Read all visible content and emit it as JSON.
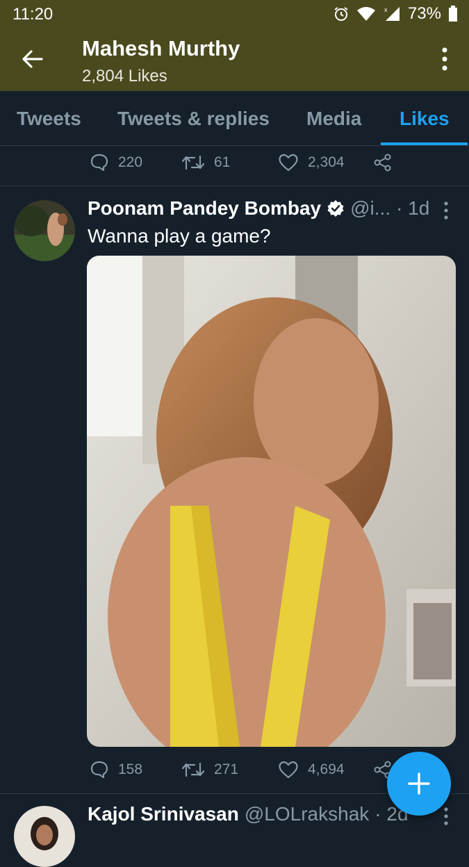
{
  "status_bar": {
    "time": "11:20",
    "battery": "73%"
  },
  "header": {
    "title": "Mahesh Murthy",
    "subtitle": "2,804 Likes"
  },
  "tabs": [
    {
      "label": "Tweets",
      "active": false
    },
    {
      "label": "Tweets & replies",
      "active": false
    },
    {
      "label": "Media",
      "active": false
    },
    {
      "label": "Likes",
      "active": true
    }
  ],
  "prev_tweet_actions": {
    "replies": "220",
    "retweets": "61",
    "likes": "2,304"
  },
  "tweets": [
    {
      "name": "Poonam Pandey Bombay",
      "verified": true,
      "handle": "@i...",
      "time": "· 1d",
      "text": "Wanna play a game?",
      "replies": "158",
      "retweets": "271",
      "likes": "4,694"
    },
    {
      "name": "Kajol Srinivasan",
      "handle": "@LOLrakshak",
      "time": "· 2d"
    }
  ],
  "colors": {
    "accent": "#1da1f2",
    "header_bg": "#4a4a1e",
    "bg": "#15202b",
    "muted": "#8899a6"
  }
}
